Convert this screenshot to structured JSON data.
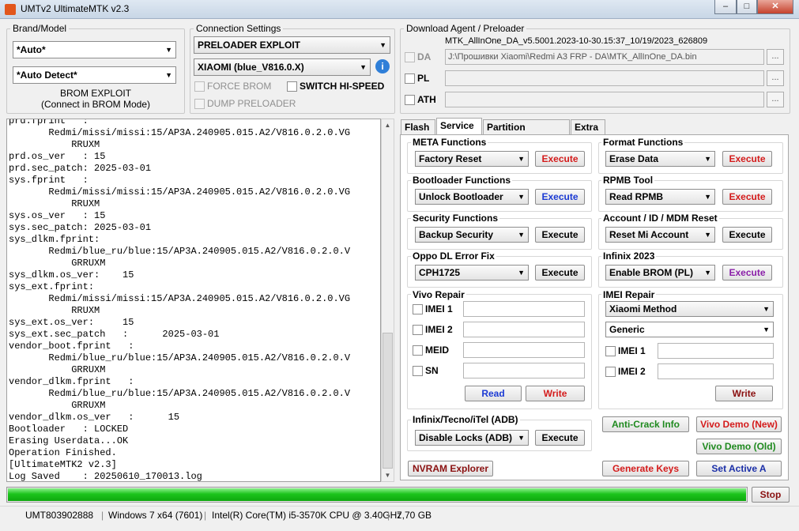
{
  "window": {
    "title": "UMTv2 UltimateMTK v2.3",
    "minimize": "–",
    "maximize": "□",
    "close": "✕"
  },
  "brand_model": {
    "label": "Brand/Model",
    "brand_value": "*Auto*",
    "model_value": "*Auto Detect*",
    "brom_line1": "BROM EXPLOIT",
    "brom_line2": "(Connect in BROM Mode)"
  },
  "connection": {
    "label": "Connection Settings",
    "mode_value": "PRELOADER EXPLOIT",
    "device_value": "XIAOMI (blue_V816.0.X)",
    "info_icon": "i",
    "force_brom": "FORCE BROM",
    "switch_highspeed": "SWITCH HI-SPEED",
    "dump_preloader": "DUMP PRELOADER"
  },
  "download_agent": {
    "label": "Download Agent / Preloader",
    "da_filename": "MTK_AllInOne_DA_v5.5001.2023-10-30.15:37_10/19/2023_626809",
    "da_label": "DA",
    "da_path": "J:\\Прошивки Xiaomi\\Redmi A3 FRP - DA\\MTK_AllInOne_DA.bin",
    "pl_label": "PL",
    "ath_label": "ATH",
    "browse": "..."
  },
  "log": [
    "prd.fprint   :",
    "       Redmi/missi/missi:15/AP3A.240905.015.A2/V816.0.2.0.VG",
    "           RRUXM",
    "prd.os_ver   : 15",
    "prd.sec_patch: 2025-03-01",
    "sys.fprint   :",
    "       Redmi/missi/missi:15/AP3A.240905.015.A2/V816.0.2.0.VG",
    "           RRUXM",
    "sys.os_ver   : 15",
    "sys.sec_patch: 2025-03-01",
    "sys_dlkm.fprint:",
    "       Redmi/blue_ru/blue:15/AP3A.240905.015.A2/V816.0.2.0.V",
    "           GRRUXM",
    "sys_dlkm.os_ver:    15",
    "sys_ext.fprint:",
    "       Redmi/missi/missi:15/AP3A.240905.015.A2/V816.0.2.0.VG",
    "           RRUXM",
    "sys_ext.os_ver:     15",
    "sys_ext.sec_patch   :      2025-03-01",
    "vendor_boot.fprint   :",
    "       Redmi/blue_ru/blue:15/AP3A.240905.015.A2/V816.0.2.0.V",
    "           GRRUXM",
    "vendor_dlkm.fprint   :",
    "       Redmi/blue_ru/blue:15/AP3A.240905.015.A2/V816.0.2.0.V",
    "           GRRUXM",
    "vendor_dlkm.os_ver   :      15",
    "Bootloader   : LOCKED",
    "Erasing Userdata...OK",
    "Operation Finished.",
    "[UltimateMTK2 v2.3]",
    "Log Saved    : 20250610_170013.log"
  ],
  "tabs": [
    "Flash",
    "Service",
    "Partition Manager",
    "Extra"
  ],
  "service": {
    "meta": {
      "title": "META Functions",
      "value": "Factory Reset",
      "action": "Execute"
    },
    "format": {
      "title": "Format Functions",
      "value": "Erase Data",
      "action": "Execute"
    },
    "bootloader": {
      "title": "Bootloader Functions",
      "value": "Unlock Bootloader",
      "action": "Execute"
    },
    "rpmb": {
      "title": "RPMB Tool",
      "value": "Read RPMB",
      "action": "Execute"
    },
    "security": {
      "title": "Security Functions",
      "value": "Backup Security",
      "action": "Execute"
    },
    "account": {
      "title": "Account / ID / MDM Reset",
      "value": "Reset Mi Account",
      "action": "Execute"
    },
    "oppo": {
      "title": "Oppo DL Error Fix",
      "value": "CPH1725",
      "action": "Execute"
    },
    "infinix2023": {
      "title": "Infinix 2023",
      "value": "Enable BROM (PL)",
      "action": "Execute"
    },
    "vivo": {
      "title": "Vivo Repair",
      "imei1": "IMEI 1",
      "imei2": "IMEI 2",
      "meid": "MEID",
      "sn": "SN",
      "read": "Read",
      "write": "Write"
    },
    "imei_repair": {
      "title": "IMEI Repair",
      "method": "Xiaomi Method",
      "type": "Generic",
      "imei1": "IMEI 1",
      "imei2": "IMEI 2",
      "write": "Write"
    },
    "infinix_adb": {
      "title": "Infinix/Tecno/iTel (ADB)",
      "value": "Disable Locks (ADB)",
      "action": "Execute"
    },
    "anti_crack": "Anti-Crack Info",
    "vivo_demo_new": "Vivo Demo (New)",
    "vivo_demo_old": "Vivo Demo (Old)",
    "nvram": "NVRAM Explorer",
    "generate_keys": "Generate Keys",
    "set_active": "Set Active A"
  },
  "progress": {
    "percent": 100,
    "stop": "Stop"
  },
  "statusbar": {
    "id": "UMT803902888",
    "os": "Windows 7 x64 (7601)",
    "cpu": "Intel(R) Core(TM) i5-3570K CPU @ 3.40GHz",
    "ram": "7,70 GB",
    "sep": "|"
  },
  "colors": {
    "accent_red": "#d41b1b",
    "accent_blue": "#1b3ad4",
    "progress_green": "#1cc41c"
  }
}
